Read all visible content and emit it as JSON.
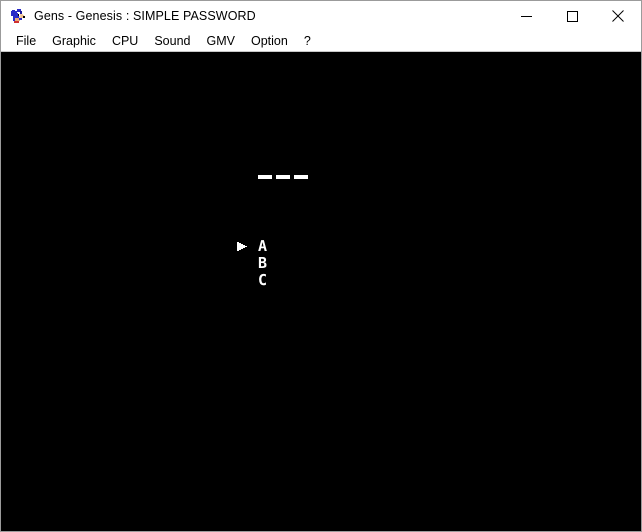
{
  "window": {
    "title": "Gens - Genesis : SIMPLE PASSWORD",
    "icon": "sonic-app-icon",
    "controls": {
      "minimize": "minimize-icon",
      "maximize": "maximize-icon",
      "close": "close-icon"
    }
  },
  "menubar": {
    "items": [
      {
        "label": "File"
      },
      {
        "label": "Graphic"
      },
      {
        "label": "CPU"
      },
      {
        "label": "Sound"
      },
      {
        "label": "GMV"
      },
      {
        "label": "Option"
      },
      {
        "label": "?"
      }
    ]
  },
  "game": {
    "background_color": "#000000",
    "foreground_color": "#ffffff",
    "password_blanks": [
      "-",
      "-",
      "-"
    ],
    "cursor": "right-arrow-cursor",
    "selected_index": 0,
    "letters": [
      {
        "char": "A"
      },
      {
        "char": "B"
      },
      {
        "char": "C"
      }
    ]
  }
}
